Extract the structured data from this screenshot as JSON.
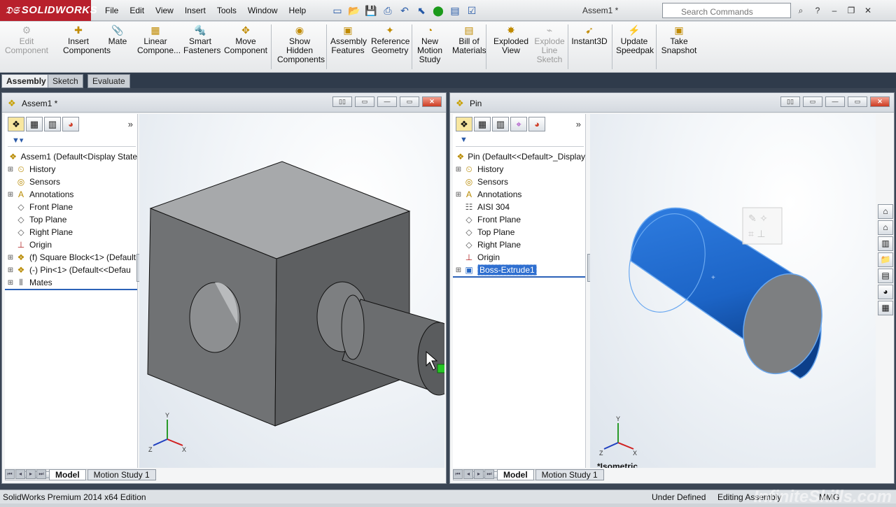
{
  "app": {
    "logo": "SOLIDWORKS",
    "doc_title": "Assem1 *"
  },
  "menu": [
    "File",
    "Edit",
    "View",
    "Insert",
    "Tools",
    "Window",
    "Help"
  ],
  "search": {
    "placeholder": "Search Commands"
  },
  "commands": [
    {
      "label": "Edit\nComponent",
      "icon": "edit-component-icon",
      "glyph": "⚙",
      "disabled": true
    },
    {
      "label": "Insert\nComponents",
      "icon": "insert-components-icon",
      "glyph": "✚"
    },
    {
      "label": "Mate",
      "icon": "mate-icon",
      "glyph": "📎"
    },
    {
      "label": "Linear\nCompone...",
      "icon": "linear-pattern-icon",
      "glyph": "▦"
    },
    {
      "label": "Smart\nFasteners",
      "icon": "smart-fasteners-icon",
      "glyph": "🔩"
    },
    {
      "label": "Move\nComponent",
      "icon": "move-component-icon",
      "glyph": "✥"
    },
    {
      "label": "Show\nHidden\nComponents",
      "icon": "show-hidden-icon",
      "glyph": "◉"
    },
    {
      "label": "Assembly\nFeatures",
      "icon": "assembly-features-icon",
      "glyph": "▣"
    },
    {
      "label": "Reference\nGeometry",
      "icon": "reference-geometry-icon",
      "glyph": "✦"
    },
    {
      "label": "New\nMotion\nStudy",
      "icon": "motion-study-icon",
      "glyph": "◔"
    },
    {
      "label": "Bill of\nMaterials",
      "icon": "bom-icon",
      "glyph": "▤"
    },
    {
      "label": "Exploded\nView",
      "icon": "exploded-view-icon",
      "glyph": "✸"
    },
    {
      "label": "Explode\nLine\nSketch",
      "icon": "explode-line-icon",
      "glyph": "⌁",
      "disabled": true
    },
    {
      "label": "Instant3D",
      "icon": "instant3d-icon",
      "glyph": "➹"
    },
    {
      "label": "Update\nSpeedpak",
      "icon": "speedpak-icon",
      "glyph": "⚡"
    },
    {
      "label": "Take\nSnapshot",
      "icon": "snapshot-icon",
      "glyph": "▣"
    }
  ],
  "cm_tabs": [
    "Assembly",
    "Sketch",
    "Evaluate"
  ],
  "left": {
    "title": "Assem1 *",
    "tree": [
      {
        "label": "Assem1  (Default<Display State",
        "icon": "assembly-icon",
        "glyph": "❖",
        "root": true
      },
      {
        "label": "History",
        "icon": "history-icon",
        "glyph": "⏲",
        "exp": true
      },
      {
        "label": "Sensors",
        "icon": "sensors-icon",
        "glyph": "◎"
      },
      {
        "label": "Annotations",
        "icon": "annotations-icon",
        "glyph": "A",
        "exp": true
      },
      {
        "label": "Front Plane",
        "icon": "plane-icon",
        "glyph": "◇"
      },
      {
        "label": "Top Plane",
        "icon": "plane-icon",
        "glyph": "◇"
      },
      {
        "label": "Right Plane",
        "icon": "plane-icon",
        "glyph": "◇"
      },
      {
        "label": "Origin",
        "icon": "origin-icon",
        "glyph": "⊥"
      },
      {
        "label": "(f) Square Block<1> (Default",
        "icon": "part-icon",
        "glyph": "❖",
        "exp": true
      },
      {
        "label": "(-) Pin<1> (Default<<Defau",
        "icon": "part-icon",
        "glyph": "❖",
        "exp": true
      },
      {
        "label": "Mates",
        "icon": "mates-icon",
        "glyph": "⫴",
        "exp": true
      }
    ],
    "tabs": [
      "Model",
      "Motion Study 1"
    ]
  },
  "right": {
    "title": "Pin",
    "tree": [
      {
        "label": "Pin  (Default<<Default>_Display",
        "icon": "part-icon",
        "glyph": "❖",
        "root": true
      },
      {
        "label": "History",
        "icon": "history-icon",
        "glyph": "⏲",
        "exp": true
      },
      {
        "label": "Sensors",
        "icon": "sensors-icon",
        "glyph": "◎"
      },
      {
        "label": "Annotations",
        "icon": "annotations-icon",
        "glyph": "A",
        "exp": true
      },
      {
        "label": "AISI 304",
        "icon": "material-icon",
        "glyph": "☷"
      },
      {
        "label": "Front Plane",
        "icon": "plane-icon",
        "glyph": "◇"
      },
      {
        "label": "Top Plane",
        "icon": "plane-icon",
        "glyph": "◇"
      },
      {
        "label": "Right Plane",
        "icon": "plane-icon",
        "glyph": "◇"
      },
      {
        "label": "Origin",
        "icon": "origin-icon",
        "glyph": "⊥"
      },
      {
        "label": "Boss-Extrude1",
        "icon": "extrude-icon",
        "glyph": "▣",
        "exp": true,
        "hl": true
      }
    ],
    "view_label": "*Isometric",
    "tabs": [
      "Model",
      "Motion Study 1"
    ]
  },
  "triad": {
    "x": "X",
    "y": "Y",
    "z": "Z"
  },
  "status": {
    "edition": "SolidWorks Premium 2014 x64 Edition",
    "defined": "Under Defined",
    "mode": "Editing Assembly",
    "units": "MMG",
    "watermark": "InfiniteSkills.com"
  },
  "colors": {
    "pin_blue": "#1c64c6",
    "close_red": "#cc3b22",
    "workarea": "#3a4554"
  }
}
